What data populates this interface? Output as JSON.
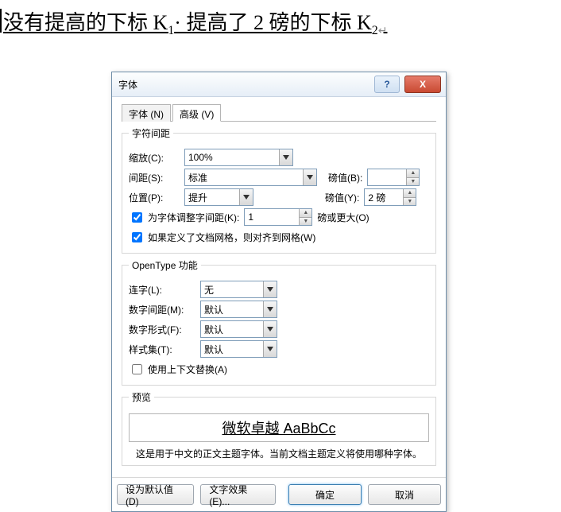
{
  "doc": {
    "part1": "没有提高的下标 K",
    "sub1": "1",
    "sep": "· ",
    "part2": "提高了 2 磅的下标 K",
    "sub2": "2",
    "ret": "↵"
  },
  "dialog": {
    "title": "字体",
    "help": "?",
    "close": "X",
    "tabs": {
      "font": "字体 (N)",
      "advanced": "高级 (V)"
    },
    "spacing_group": "字符间距",
    "scale_label": "缩放(C):",
    "scale_value": "100%",
    "spacing_label": "间距(S):",
    "spacing_value": "标准",
    "spacing_pt_label": "磅值(B):",
    "spacing_pt_value": "",
    "position_label": "位置(P):",
    "position_value": "提升",
    "position_pt_label": "磅值(Y):",
    "position_pt_value": "2 磅",
    "kerning_cb": "为字体调整字间距(K):",
    "kerning_value": "1",
    "kerning_suffix": "磅或更大(O)",
    "snapgrid_cb": "如果定义了文档网格，则对齐到网格(W)",
    "opentype_group": "OpenType 功能",
    "ligature_label": "连字(L):",
    "ligature_value": "无",
    "numspacing_label": "数字间距(M):",
    "numspacing_value": "默认",
    "numform_label": "数字形式(F):",
    "numform_value": "默认",
    "styleset_label": "样式集(T):",
    "styleset_value": "默认",
    "context_cb": "使用上下文替换(A)",
    "preview_group": "预览",
    "preview_text": "微软卓越 AaBbCc",
    "preview_desc": "这是用于中文的正文主题字体。当前文档主题定义将使用哪种字体。",
    "btn_default": "设为默认值(D)",
    "btn_effects": "文字效果(E)...",
    "btn_ok": "确定",
    "btn_cancel": "取消"
  }
}
